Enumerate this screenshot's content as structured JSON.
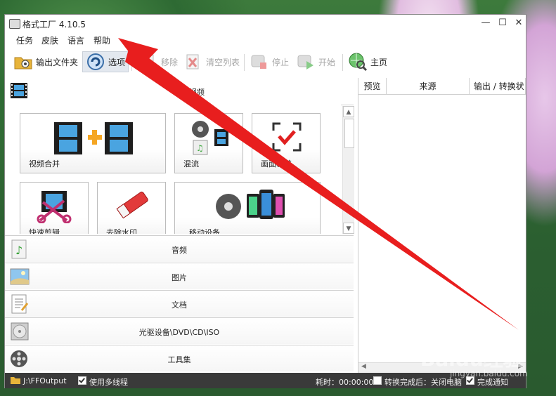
{
  "window": {
    "title": "格式工厂 4.10.5"
  },
  "menu": [
    "任务",
    "皮肤",
    "语言",
    "帮助"
  ],
  "toolbar": {
    "output_folder": "输出文件夹",
    "options": "选项",
    "remove": "移除",
    "clear_list": "清空列表",
    "stop": "停止",
    "start": "开始",
    "home": "主页"
  },
  "video_category": {
    "label": "视频"
  },
  "tiles": [
    "视频合并",
    "混流",
    "画面裁剪",
    "快速剪辑",
    "去除水印",
    "移动设备"
  ],
  "categories": [
    "音频",
    "图片",
    "文档",
    "光驱设备\\DVD\\CD\\ISO",
    "工具集"
  ],
  "task_columns": [
    "预览",
    "来源",
    "输出 / 转换状"
  ],
  "status": {
    "output_path": "J:\\FFOutput",
    "multithread": "使用多线程",
    "elapsed": "耗时：00:00:00",
    "after_convert": "转换完成后：关闭电脑",
    "notify": "完成通知"
  },
  "watermark": {
    "brand": "Baidu经验",
    "site": "jingyan.baidu.com"
  },
  "colors": {
    "arrow": "#e81e1e",
    "statusbar": "#3a3a3a",
    "accent_film": "#2a6fb5"
  }
}
